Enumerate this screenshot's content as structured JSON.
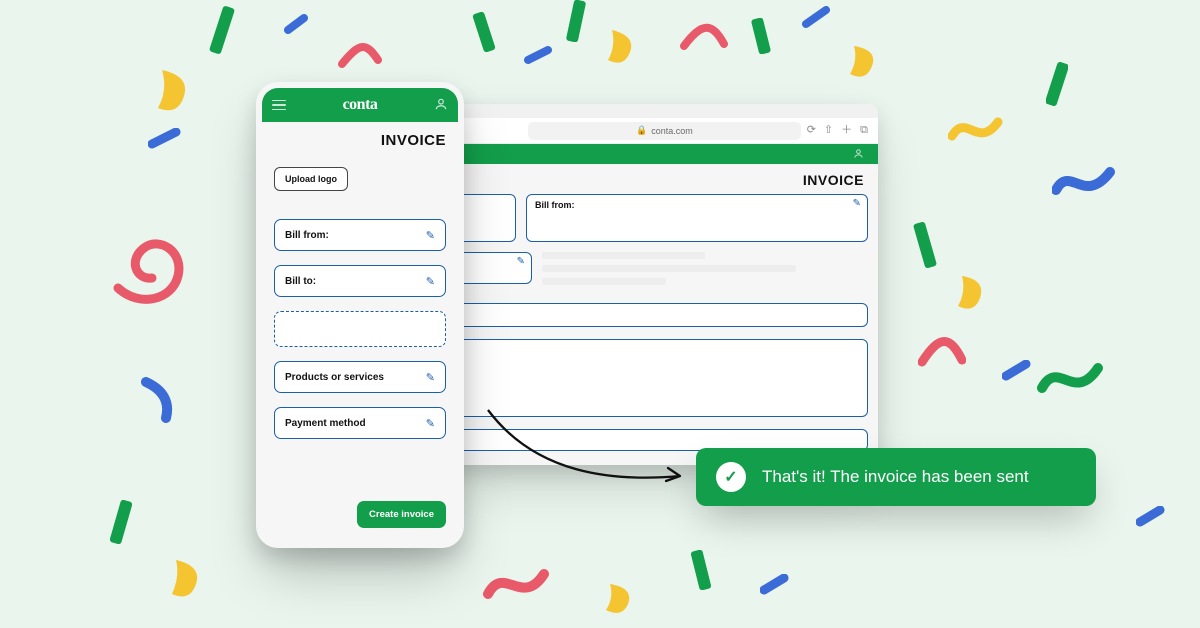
{
  "brand": {
    "logo_text": "conta"
  },
  "browser": {
    "url": "conta.com",
    "title": "INVOICE",
    "bill_from_label": "Bill from:"
  },
  "phone": {
    "title": "INVOICE",
    "upload_label": "Upload logo",
    "fields": {
      "bill_from": "Bill from:",
      "bill_to": "Bill to:",
      "products": "Products or services",
      "payment": "Payment method"
    },
    "cta": "Create invoice"
  },
  "toast": {
    "message": "That's it! The invoice has been sent"
  },
  "icons": {
    "edit": "✎",
    "lock": "🔒",
    "user": "◯",
    "check": "✓"
  }
}
